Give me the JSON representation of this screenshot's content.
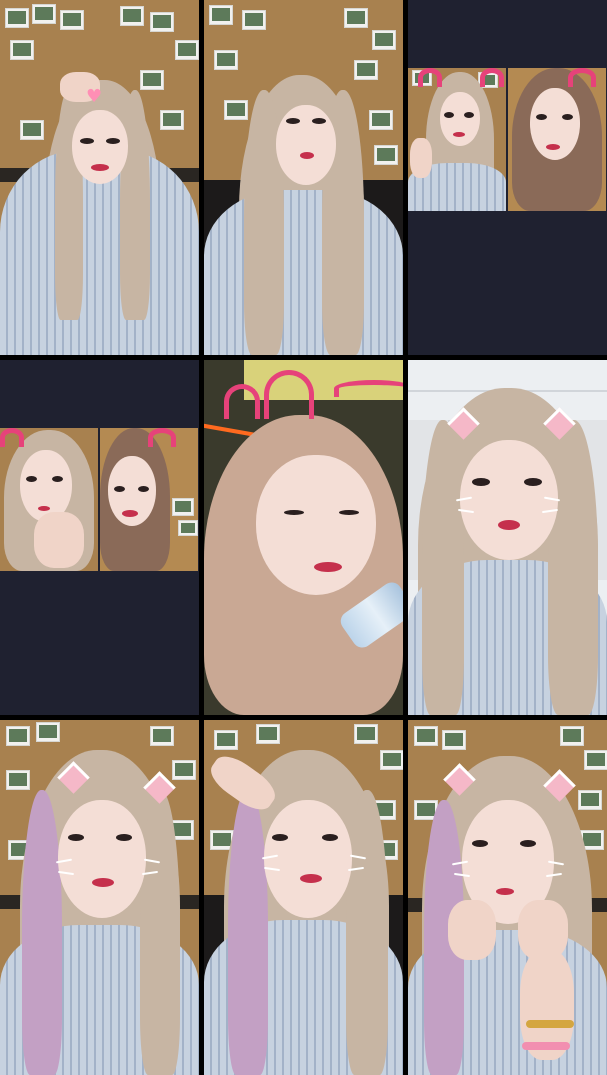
{
  "layout": {
    "type": "video-grid",
    "columns": 3,
    "rows": 3
  },
  "colors": {
    "grid_gap": "#000000",
    "empty_tile": "#1f2130",
    "cork_wall": "#a8814f",
    "hair": "#c7b5a3",
    "lip": "#c5304c",
    "cat_ear_pink": "#f5b8c8",
    "neon_pink": "#e6427a"
  },
  "tiles": [
    {
      "id": "tile-1",
      "type": "video",
      "effect": "heart",
      "background": "photo-wall"
    },
    {
      "id": "tile-2",
      "type": "video",
      "effect": "none",
      "background": "photo-wall"
    },
    {
      "id": "tile-3",
      "type": "split-video",
      "effect": "pink-ears",
      "background": "empty"
    },
    {
      "id": "tile-4",
      "type": "split-video",
      "effect": "pink-ears",
      "background": "empty"
    },
    {
      "id": "tile-5",
      "type": "video",
      "effect": "pink-ears",
      "background": "neon-mall"
    },
    {
      "id": "tile-6",
      "type": "video",
      "effect": "cat-ears-whiskers",
      "background": "office-ceiling"
    },
    {
      "id": "tile-7",
      "type": "video",
      "effect": "cat-ears-whiskers",
      "background": "photo-wall"
    },
    {
      "id": "tile-8",
      "type": "video",
      "effect": "cat-ears-whiskers",
      "background": "photo-wall"
    },
    {
      "id": "tile-9",
      "type": "video",
      "effect": "cat-ears-whiskers",
      "background": "photo-wall"
    }
  ],
  "icons": {
    "heart": "heart-icon"
  }
}
